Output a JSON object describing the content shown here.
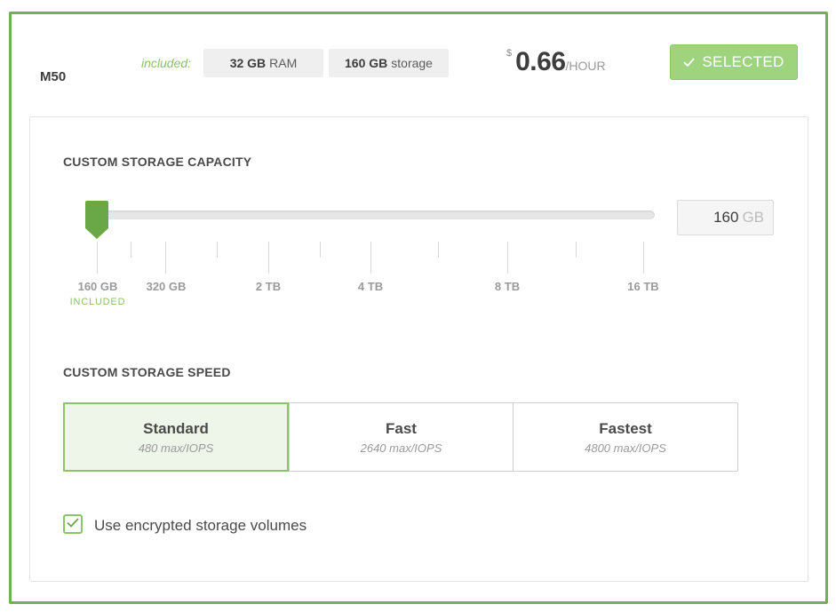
{
  "plan": {
    "tier": "M50",
    "included_label": "included:",
    "ram_value": "32 GB",
    "ram_label": "RAM",
    "storage_value": "160 GB",
    "storage_label": "storage",
    "price_currency": "$",
    "price_amount": "0.66",
    "price_unit": "/HOUR",
    "selected_label": "SELECTED"
  },
  "storage_capacity": {
    "title": "CUSTOM STORAGE CAPACITY",
    "value": "160",
    "unit": "GB",
    "slider_position": 0,
    "ticks": [
      "160 GB",
      "320 GB",
      "2 TB",
      "4 TB",
      "8 TB",
      "16 TB"
    ],
    "included_tag": "INCLUDED"
  },
  "storage_speed": {
    "title": "CUSTOM STORAGE SPEED",
    "options": [
      {
        "name": "Standard",
        "iops": "480 max/IOPS",
        "selected": true
      },
      {
        "name": "Fast",
        "iops": "2640 max/IOPS",
        "selected": false
      },
      {
        "name": "Fastest",
        "iops": "4800 max/IOPS",
        "selected": false
      }
    ]
  },
  "encryption": {
    "label": "Use encrypted storage volumes",
    "checked": true
  },
  "colors": {
    "accent": "#72b24e",
    "button_bg": "#9ed47d",
    "included_text": "#8bc36a",
    "selected_option_bg": "#eef6e9"
  }
}
